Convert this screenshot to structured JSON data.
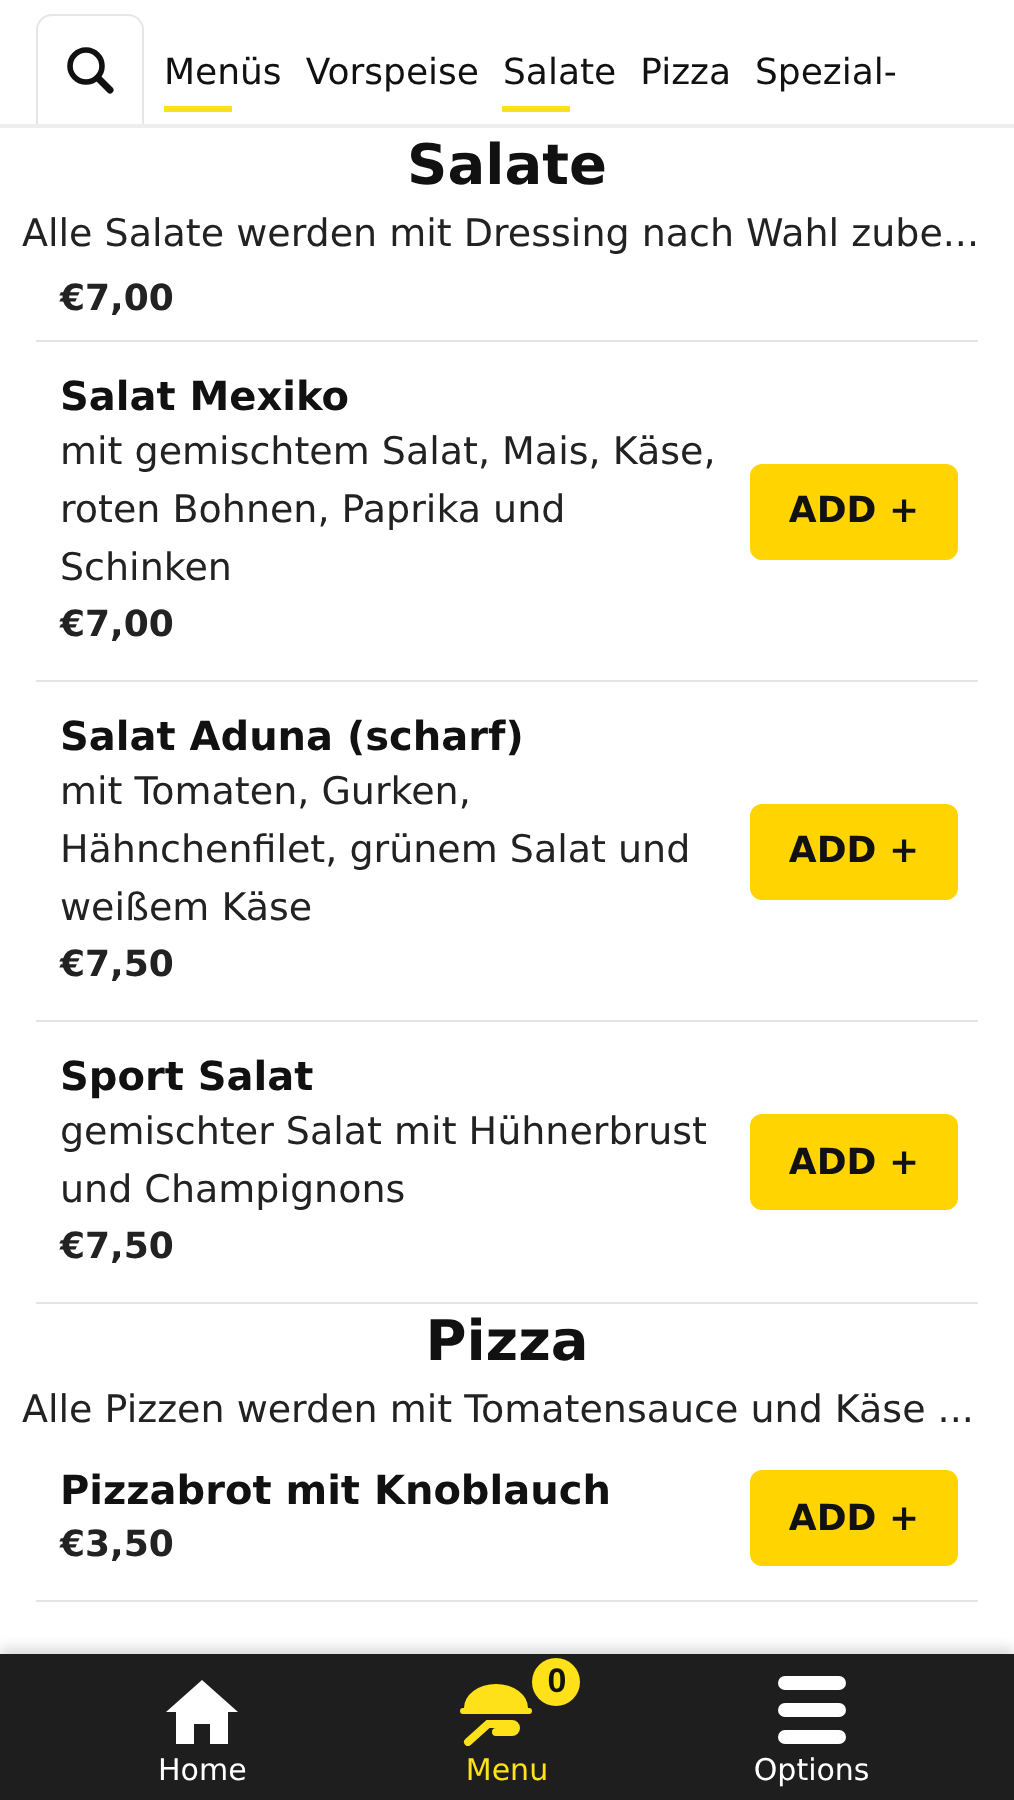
{
  "tabs": [
    {
      "label": "Menüs",
      "selected": true
    },
    {
      "label": "Vorspeise",
      "selected": false
    },
    {
      "label": "Salate",
      "selected": true
    },
    {
      "label": "Pizza",
      "selected": false
    },
    {
      "label": "Spezial-",
      "selected": false
    }
  ],
  "sections": [
    {
      "title": "Salate",
      "description": "Alle Salate werden mit Dressing nach Wahl zube...",
      "items": [
        {
          "kind": "price_only",
          "price": "€7,00"
        },
        {
          "kind": "dish",
          "name": "Salat Mexiko",
          "description": "mit gemischtem Salat, Mais, Käse, roten Bohnen, Paprika und Schinken",
          "price": "€7,00",
          "button": "ADD +"
        },
        {
          "kind": "dish",
          "name": "Salat Aduna (scharf)",
          "description": "mit Tomaten, Gurken, Hähnchenfilet, grünem Salat und weißem Käse",
          "price": "€7,50",
          "button": "ADD +"
        },
        {
          "kind": "dish",
          "name": "Sport Salat",
          "description": "gemischter Salat mit Hühnerbrust und Champignons",
          "price": "€7,50",
          "button": "ADD +"
        }
      ]
    },
    {
      "title": "Pizza",
      "description": "Alle Pizzen werden mit Tomatensauce und Käse ...",
      "items": [
        {
          "kind": "dish",
          "name": "Pizzabrot mit Knoblauch",
          "price": "€3,50",
          "button": "ADD +"
        }
      ]
    }
  ],
  "bottom_nav": [
    {
      "kind": "home",
      "label": "Home",
      "selected": false
    },
    {
      "kind": "menu",
      "label": "Menu",
      "selected": true,
      "badge": "0"
    },
    {
      "kind": "options",
      "label": "Options",
      "selected": false
    }
  ]
}
